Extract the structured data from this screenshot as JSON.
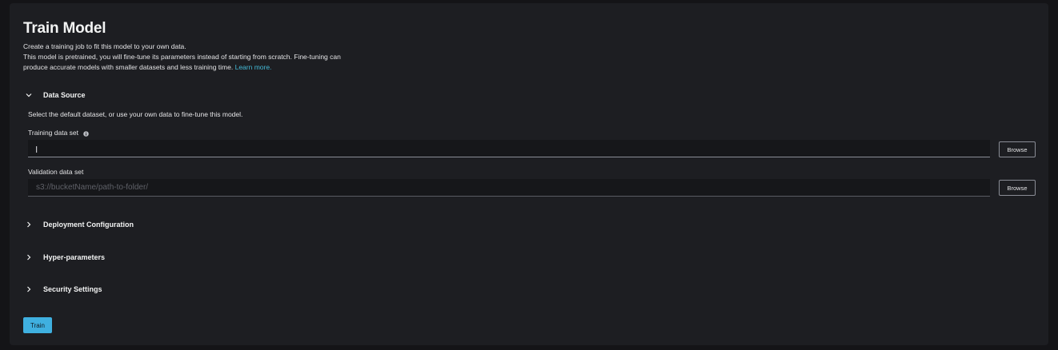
{
  "header": {
    "title": "Train Model",
    "description_line1": "Create a training job to fit this model to your own data.",
    "description_line2": "This model is pretrained, you will fine-tune its parameters instead of starting from scratch. Fine-tuning can",
    "description_line3": "produce accurate models with smaller datasets and less training time.",
    "learn_more": "Learn more."
  },
  "data_source": {
    "label": "Data Source",
    "expanded": true,
    "description": "Select the default dataset, or use your own data to fine-tune this model.",
    "training": {
      "label": "Training data set",
      "value": "",
      "browse_label": "Browse"
    },
    "validation": {
      "label": "Validation data set",
      "value": "",
      "placeholder": "s3://bucketName/path-to-folder/",
      "browse_label": "Browse"
    }
  },
  "sections": {
    "deployment": "Deployment Configuration",
    "hyperparameters": "Hyper-parameters",
    "security": "Security Settings"
  },
  "actions": {
    "train_label": "Train"
  },
  "colors": {
    "accent": "#3fb0e0",
    "link": "#44b9d6",
    "panel_bg": "#1d1e22",
    "page_bg": "#141417"
  }
}
